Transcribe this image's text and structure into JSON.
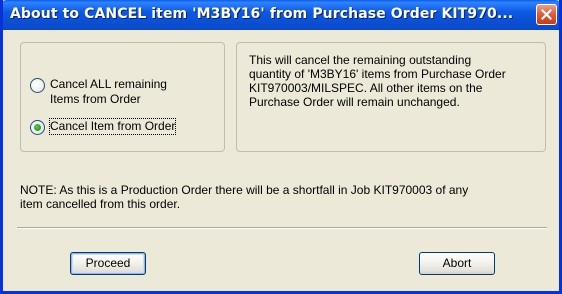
{
  "window": {
    "title": "About to CANCEL item 'M3BY16' from Purchase Order KIT970..."
  },
  "options": [
    {
      "label_line1": "Cancel ALL remaining",
      "label_line2": "Items from Order",
      "selected": false
    },
    {
      "label_line1": "Cancel Item from Order",
      "selected": true
    }
  ],
  "description": {
    "lines": [
      "This will cancel the remaining outstanding",
      "quantity of 'M3BY16' items from Purchase Order",
      "KIT970003/MILSPEC. All other items on the",
      "Purchase Order will remain unchanged."
    ]
  },
  "note": {
    "line1": "NOTE: As this is a Production Order there will be a shortfall in Job KIT970003 of any",
    "line2": "item cancelled from this order."
  },
  "buttons": {
    "proceed": "Proceed",
    "abort": "Abort"
  },
  "colors": {
    "titlebar": "#0a4fd4",
    "window_bg": "#ece9d8",
    "close_button": "#e0603e",
    "radio_selected": "#21a121"
  },
  "icons": {
    "close": "close-x-icon"
  }
}
